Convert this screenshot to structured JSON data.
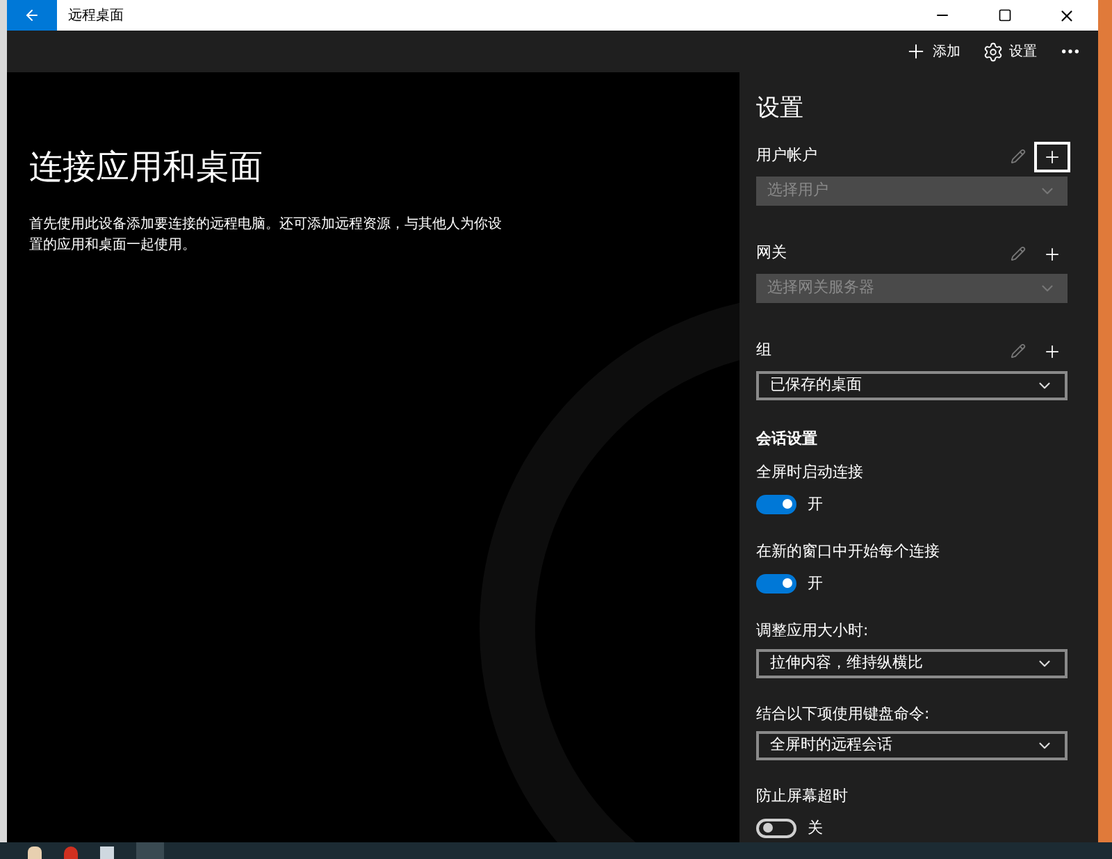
{
  "window": {
    "title": "远程桌面"
  },
  "toolbar": {
    "actions": [
      {
        "kind": "add",
        "label": "添加"
      },
      {
        "kind": "settings",
        "label": "设置"
      }
    ]
  },
  "main": {
    "heading": "连接应用和桌面",
    "description": "首先使用此设备添加要连接的远程电脑。还可添加远程资源，与其他人为你设置的应用和桌面一起使用。"
  },
  "settings": {
    "title": "设置",
    "groups": [
      {
        "label": "用户帐户",
        "placeholder": "选择用户",
        "disabled": true,
        "add_focused": true
      },
      {
        "label": "网关",
        "placeholder": "选择网关服务器",
        "disabled": true,
        "add_focused": false
      },
      {
        "label": "组",
        "value": "已保存的桌面",
        "disabled": false,
        "add_focused": false
      }
    ],
    "session_title": "会话设置",
    "options": [
      {
        "kind": "toggle",
        "label": "全屏时启动连接",
        "on": true,
        "state_text": "开"
      },
      {
        "kind": "toggle",
        "label": "在新的窗口中开始每个连接",
        "on": true,
        "state_text": "开"
      },
      {
        "kind": "select",
        "label": "调整应用大小时:",
        "value": "拉伸内容，维持纵横比"
      },
      {
        "kind": "select",
        "label": "结合以下项使用键盘命令:",
        "value": "全屏时的远程会话"
      },
      {
        "kind": "toggle",
        "label": "防止屏幕超时",
        "on": false,
        "state_text": "关"
      }
    ]
  }
}
